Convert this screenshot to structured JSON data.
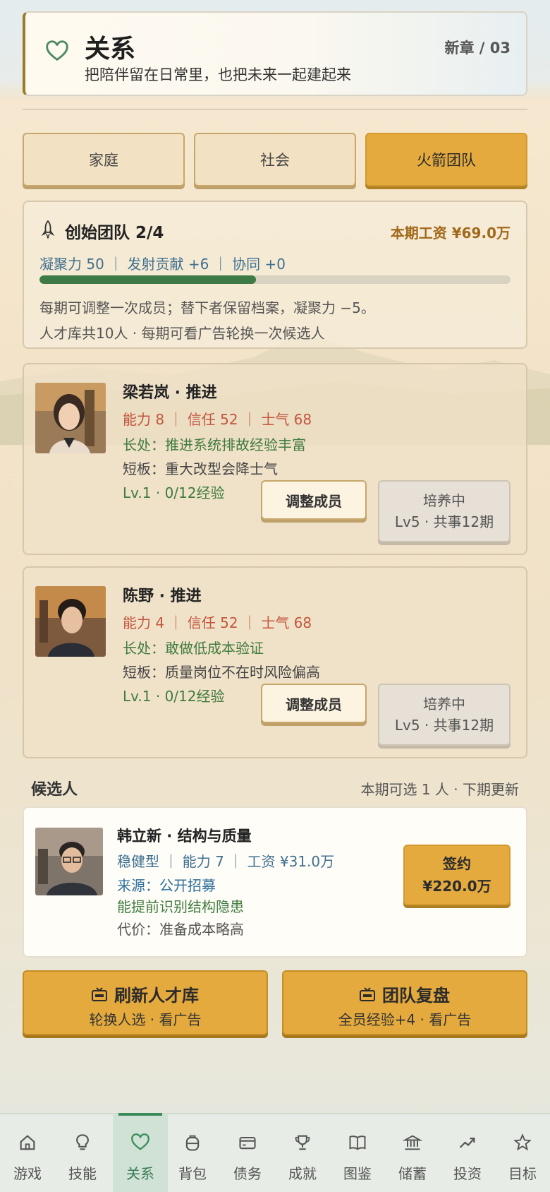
{
  "header": {
    "title": "关系",
    "subtitle": "把陪伴留在日常里，也把未来一起建起来",
    "chapter": "新章 / 03",
    "icon": "heart-icon"
  },
  "tabs": [
    {
      "label": "家庭",
      "active": false
    },
    {
      "label": "社会",
      "active": false
    },
    {
      "label": "火箭团队",
      "active": true
    }
  ],
  "team": {
    "title": "创始团队 2/4",
    "salary": "本期工资 ¥69.0万",
    "stats": "凝聚力 50 ｜ 发射贡献 +6 ｜ 协同 +0",
    "cohesion": 0.46,
    "note1": "每期可调整一次成员；替下者保留档案，凝聚力 −5。",
    "note2": "人才库共10人 · 每期可看广告轮换一次候选人"
  },
  "members": [
    {
      "name": "梁若岚 · 推进",
      "attrs": "能力 8 ｜ 信任 52 ｜ 士气 68",
      "strength": "长处：推进系统排故经验丰富",
      "weakness": "短板：重大改型会降士气",
      "level": "Lv.1 · 0/12经验",
      "adjust_label": "调整成员",
      "train_line1": "培养中",
      "train_line2": "Lv5 · 共事12期"
    },
    {
      "name": "陈野 · 推进",
      "attrs": "能力 4 ｜ 信任 52 ｜ 士气 68",
      "strength": "长处：敢做低成本验证",
      "weakness": "短板：质量岗位不在时风险偏高",
      "level": "Lv.1 · 0/12经验",
      "adjust_label": "调整成员",
      "train_line1": "培养中",
      "train_line2": "Lv5 · 共事12期"
    }
  ],
  "candidates": {
    "title": "候选人",
    "note": "本期可选 1 人 · 下期更新",
    "items": [
      {
        "name": "韩立新 · 结构与质量",
        "attrs": "稳健型 ｜ 能力 7 ｜ 工资 ¥31.0万",
        "source": "来源：公开招募",
        "advantage": "能提前识别结构隐患",
        "cost": "代价：准备成本略高",
        "sign_label": "签约",
        "sign_price": "¥220.0万"
      }
    ]
  },
  "actions": [
    {
      "title": "刷新人才库",
      "sub": "轮换人选 · 看广告",
      "icon": "tv-icon"
    },
    {
      "title": "团队复盘",
      "sub": "全员经验+4 · 看广告",
      "icon": "tv-icon"
    }
  ],
  "nav": [
    {
      "label": "游戏",
      "icon": "home-icon",
      "active": false
    },
    {
      "label": "技能",
      "icon": "bulb-icon",
      "active": false
    },
    {
      "label": "关系",
      "icon": "heart-icon",
      "active": true
    },
    {
      "label": "背包",
      "icon": "backpack-icon",
      "active": false
    },
    {
      "label": "债务",
      "icon": "card-icon",
      "active": false
    },
    {
      "label": "成就",
      "icon": "trophy-icon",
      "active": false
    },
    {
      "label": "图鉴",
      "icon": "book-icon",
      "active": false
    },
    {
      "label": "储蓄",
      "icon": "bank-icon",
      "active": false
    },
    {
      "label": "投资",
      "icon": "trend-icon",
      "active": false
    },
    {
      "label": "目标",
      "icon": "star-icon",
      "active": false
    }
  ],
  "colors": {
    "accent": "#e4aa3e",
    "green": "#3d7a46",
    "red": "#c4563e",
    "blue": "#3f6f8f"
  }
}
